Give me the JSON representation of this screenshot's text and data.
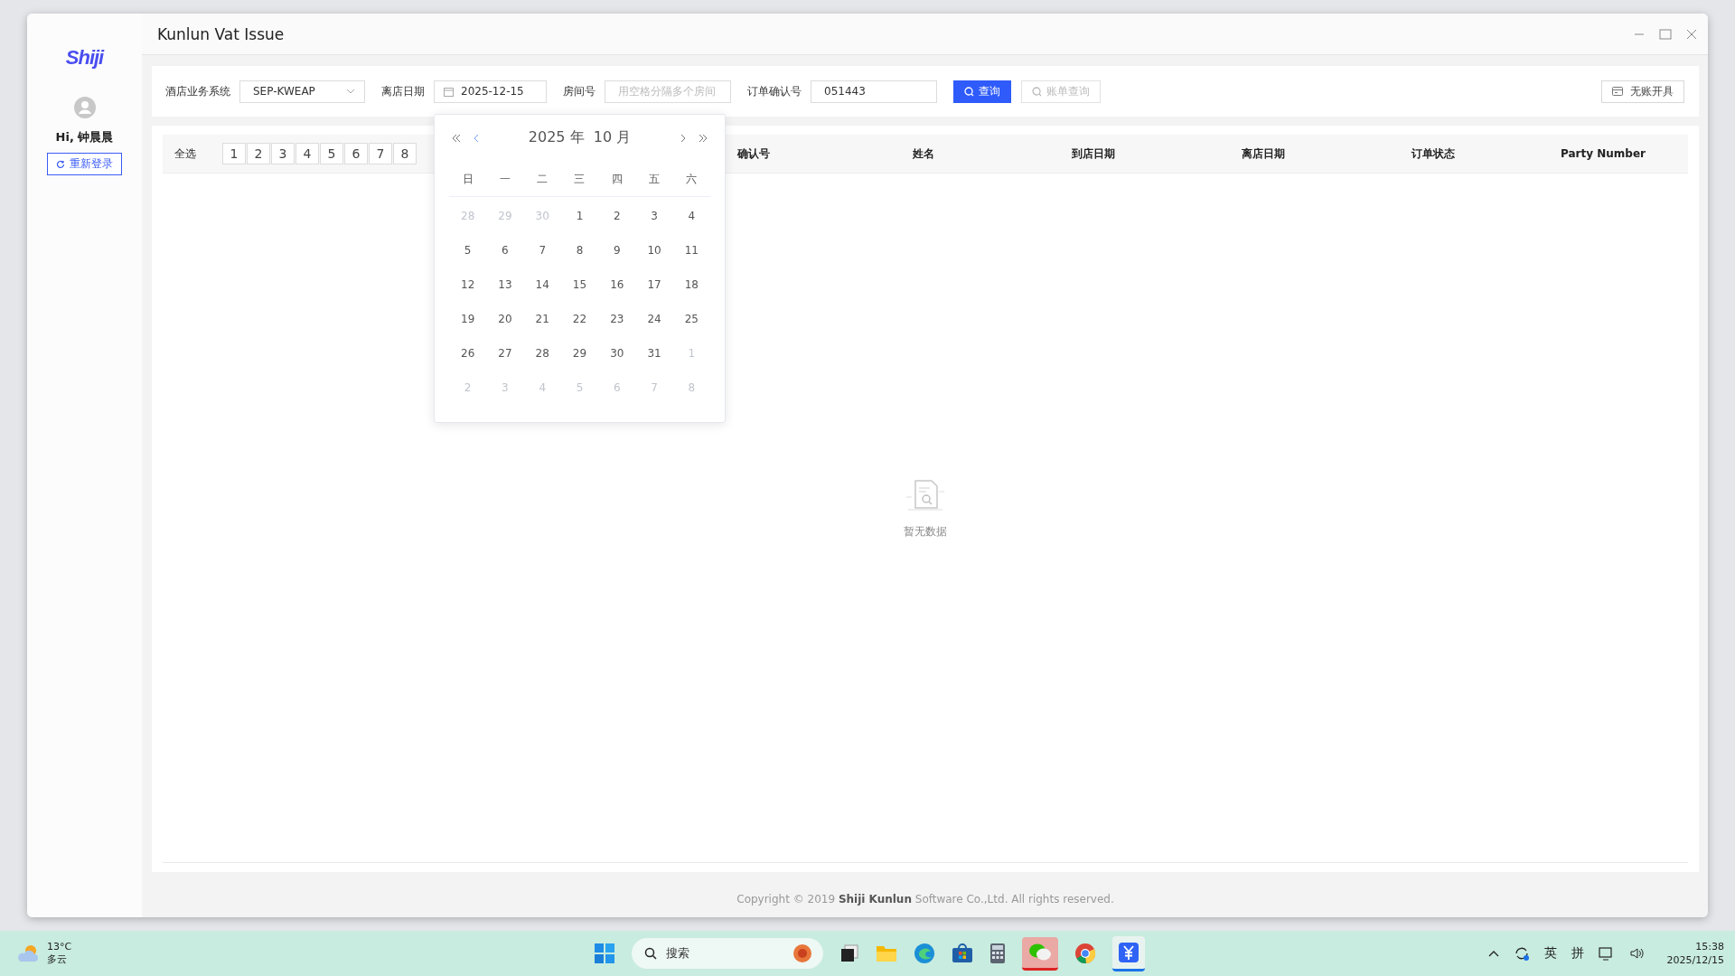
{
  "window": {
    "title": "Kunlun Vat Issue"
  },
  "sidebar": {
    "logo": "Shiji",
    "greeting": "Hi, 钟晨晨",
    "relogin_button": "重新登录"
  },
  "filters": [
    {
      "kind": "select",
      "label": "酒店业务系统",
      "value": "SEP-KWEAP"
    },
    {
      "kind": "date",
      "label": "离店日期",
      "value": "2025-12-15"
    },
    {
      "kind": "text",
      "label": "房间号",
      "placeholder": "用空格分隔多个房间"
    },
    {
      "kind": "text",
      "label": "订单确认号",
      "value": "051443"
    }
  ],
  "buttons": [
    {
      "label": "查询",
      "disabled": false
    },
    {
      "label": "账单查询",
      "disabled": true
    }
  ],
  "no_account_button": "无账开具",
  "table": {
    "select_all": "全选",
    "pages": [
      "1",
      "2",
      "3",
      "4",
      "5",
      "6",
      "7",
      "8"
    ],
    "columns": [
      "确认号",
      "姓名",
      "到店日期",
      "离店日期",
      "订单状态",
      "Party Number"
    ],
    "empty_text": "暂无数据"
  },
  "calendar": {
    "title": "2025 年  10 月",
    "weekdays": [
      "日",
      "一",
      "二",
      "三",
      "四",
      "五",
      "六"
    ],
    "days": [
      {
        "label": "28",
        "in_month": false
      },
      {
        "label": "29",
        "in_month": false
      },
      {
        "label": "30",
        "in_month": false
      },
      {
        "label": "1",
        "in_month": true
      },
      {
        "label": "2",
        "in_month": true
      },
      {
        "label": "3",
        "in_month": true
      },
      {
        "label": "4",
        "in_month": true
      },
      {
        "label": "5",
        "in_month": true
      },
      {
        "label": "6",
        "in_month": true
      },
      {
        "label": "7",
        "in_month": true
      },
      {
        "label": "8",
        "in_month": true
      },
      {
        "label": "9",
        "in_month": true
      },
      {
        "label": "10",
        "in_month": true
      },
      {
        "label": "11",
        "in_month": true
      },
      {
        "label": "12",
        "in_month": true
      },
      {
        "label": "13",
        "in_month": true
      },
      {
        "label": "14",
        "in_month": true
      },
      {
        "label": "15",
        "in_month": true
      },
      {
        "label": "16",
        "in_month": true
      },
      {
        "label": "17",
        "in_month": true
      },
      {
        "label": "18",
        "in_month": true
      },
      {
        "label": "19",
        "in_month": true
      },
      {
        "label": "20",
        "in_month": true
      },
      {
        "label": "21",
        "in_month": true
      },
      {
        "label": "22",
        "in_month": true
      },
      {
        "label": "23",
        "in_month": true
      },
      {
        "label": "24",
        "in_month": true
      },
      {
        "label": "25",
        "in_month": true
      },
      {
        "label": "26",
        "in_month": true
      },
      {
        "label": "27",
        "in_month": true
      },
      {
        "label": "28",
        "in_month": true
      },
      {
        "label": "29",
        "in_month": true
      },
      {
        "label": "30",
        "in_month": true
      },
      {
        "label": "31",
        "in_month": true
      },
      {
        "label": "1",
        "in_month": false
      },
      {
        "label": "2",
        "in_month": false
      },
      {
        "label": "3",
        "in_month": false
      },
      {
        "label": "4",
        "in_month": false
      },
      {
        "label": "5",
        "in_month": false
      },
      {
        "label": "6",
        "in_month": false
      },
      {
        "label": "7",
        "in_month": false
      },
      {
        "label": "8",
        "in_month": false
      }
    ]
  },
  "footer": "Copyright © 2019 **Shiji Kunlun** Software Co.,Ltd. All rights reserved.",
  "taskbar": {
    "weather_temp": "13°C",
    "weather_text": "多云",
    "search_placeholder": "搜索",
    "ime": [
      "英",
      "拼"
    ],
    "time": "15:38",
    "date": "2025/12/15"
  }
}
